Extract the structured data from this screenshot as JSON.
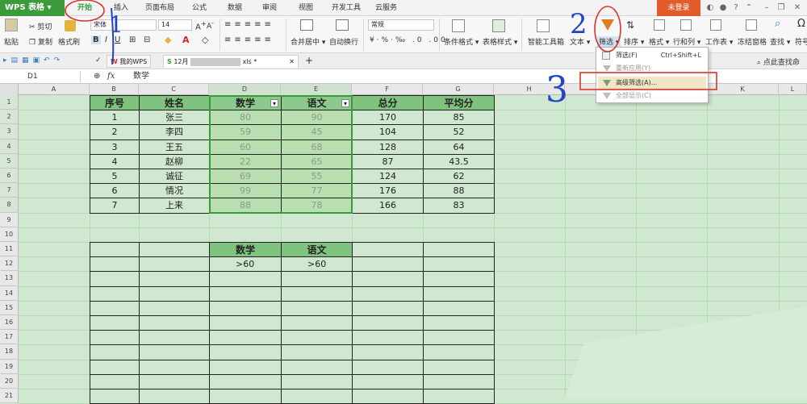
{
  "app": {
    "logo": "WPS 表格",
    "login_button": "未登录"
  },
  "menu_tabs": [
    "开始",
    "插入",
    "页面布局",
    "公式",
    "数据",
    "审阅",
    "视图",
    "开发工具",
    "云服务"
  ],
  "ribbon": {
    "paste": "粘贴",
    "cut": "剪切",
    "copy": "复制",
    "format_painter": "格式刷",
    "font_name": "宋体",
    "font_size": "14",
    "merge_center": "合并居中",
    "auto_wrap": "自动换行",
    "number_format": "常规",
    "conditional_format": "条件格式",
    "table_style": "表格样式",
    "smart_toolbox": "智能工具箱",
    "text": "文本",
    "filter": "筛选",
    "sort": "排序",
    "format": "格式",
    "row_col": "行和列",
    "worksheet": "工作表",
    "freeze": "冻结窗格",
    "find": "查找",
    "symbol": "符号"
  },
  "doc_tabs": [
    {
      "label": "我的WPS"
    },
    {
      "label": "12月",
      "suffix": "xls *"
    }
  ],
  "search_hint": "点此查找命",
  "formula_bar": {
    "cell_ref": "D1",
    "fx": "fx",
    "content": "数学"
  },
  "columns": [
    "A",
    "B",
    "C",
    "D",
    "E",
    "F",
    "G",
    "H",
    "I",
    "J",
    "K",
    "L"
  ],
  "rows": [
    "1",
    "2",
    "3",
    "4",
    "5",
    "6",
    "7",
    "8",
    "9",
    "10",
    "11",
    "12",
    "13",
    "14",
    "15",
    "16",
    "17",
    "18",
    "19",
    "20",
    "21"
  ],
  "table1": {
    "headers": [
      "序号",
      "姓名",
      "数学",
      "语文",
      "总分",
      "平均分"
    ],
    "rows": [
      [
        "1",
        "张三",
        "80",
        "90",
        "170",
        "85"
      ],
      [
        "2",
        "李四",
        "59",
        "45",
        "104",
        "52"
      ],
      [
        "3",
        "王五",
        "60",
        "68",
        "128",
        "64"
      ],
      [
        "4",
        "赵柳",
        "22",
        "65",
        "87",
        "43.5"
      ],
      [
        "5",
        "诚征",
        "69",
        "55",
        "124",
        "62"
      ],
      [
        "6",
        "情况",
        "99",
        "77",
        "176",
        "88"
      ],
      [
        "7",
        "上来",
        "88",
        "78",
        "166",
        "83"
      ]
    ]
  },
  "criteria": {
    "headers": [
      "数学",
      "语文"
    ],
    "values": [
      ">60",
      ">60"
    ]
  },
  "dropdown": {
    "items": [
      {
        "label": "筛选(F)",
        "shortcut": "Ctrl+Shift+L"
      },
      {
        "label": "重新应用(Y)"
      },
      {
        "label": "高级筛选(A)..."
      },
      {
        "label": "全部显示(C)"
      }
    ]
  },
  "annotations": [
    "1",
    "2",
    "3"
  ],
  "colors": {
    "brand": "#3b9b3b",
    "login": "#e15b2b",
    "header_fill": "#7fc37f",
    "sheet_bg": "#cfe8cf",
    "annotation_red": "#d9342b",
    "annotation_blue": "#2245c2"
  }
}
